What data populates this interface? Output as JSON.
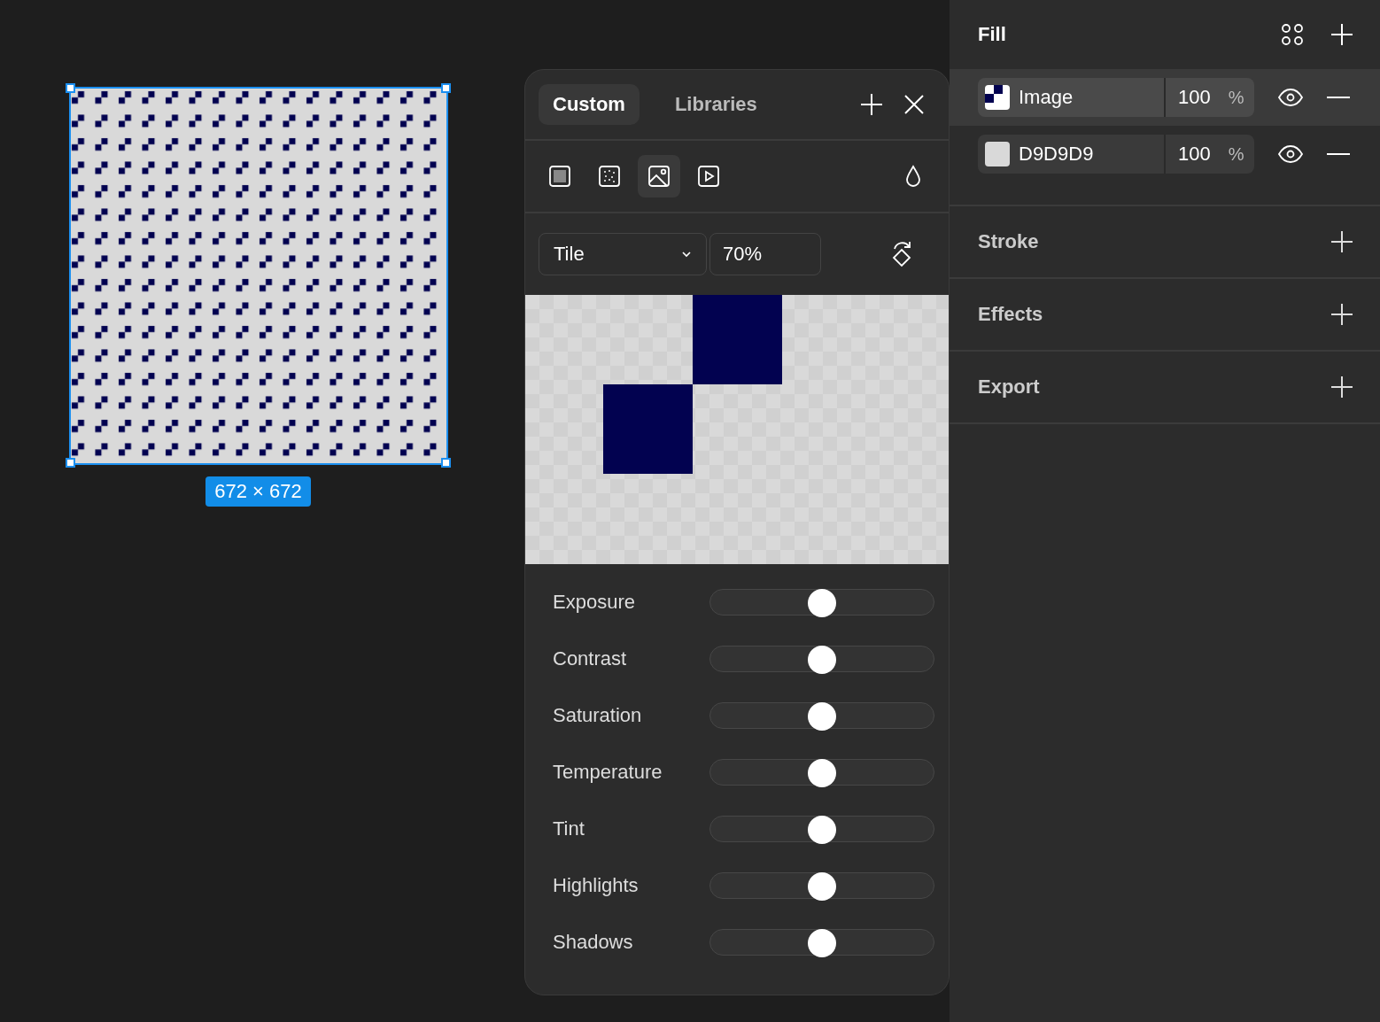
{
  "canvas": {
    "size_label": "672 × 672"
  },
  "image_panel": {
    "tabs": [
      {
        "label": "Custom",
        "selected": true
      },
      {
        "label": "Libraries",
        "selected": false
      }
    ],
    "fill_types": [
      {
        "kind": "solid",
        "selected": false
      },
      {
        "kind": "noise",
        "selected": false
      },
      {
        "kind": "image",
        "selected": true
      },
      {
        "kind": "video",
        "selected": false
      }
    ],
    "mode": "Tile",
    "scale": "70%",
    "adjustments": [
      {
        "label": "Exposure",
        "level": 0.5
      },
      {
        "label": "Contrast",
        "level": 0.5
      },
      {
        "label": "Saturation",
        "level": 0.5
      },
      {
        "label": "Temperature",
        "level": 0.5
      },
      {
        "label": "Tint",
        "level": 0.5
      },
      {
        "label": "Highlights",
        "level": 0.5
      },
      {
        "label": "Shadows",
        "level": 0.5
      }
    ]
  },
  "properties": {
    "fill": {
      "title": "Fill",
      "items": [
        {
          "kind": "image",
          "name": "Image",
          "opacity": "100",
          "unit": "%",
          "selected": true
        },
        {
          "kind": "solid",
          "name": "D9D9D9",
          "color": "#d9d9d9",
          "opacity": "100",
          "unit": "%",
          "selected": false
        }
      ]
    },
    "sections": [
      {
        "title": "Stroke"
      },
      {
        "title": "Effects"
      },
      {
        "title": "Export"
      }
    ]
  }
}
